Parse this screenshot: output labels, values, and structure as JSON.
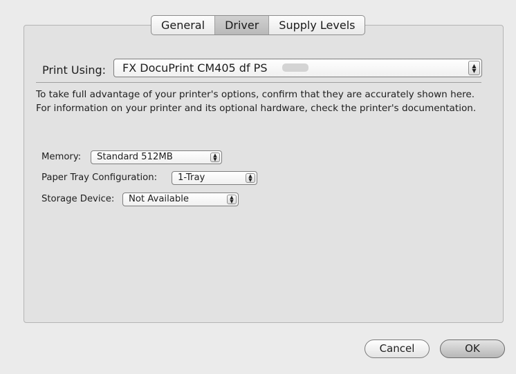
{
  "tabs": [
    {
      "label": "General",
      "selected": false
    },
    {
      "label": "Driver",
      "selected": true
    },
    {
      "label": "Supply Levels",
      "selected": false
    }
  ],
  "print_using": {
    "label": "Print Using:",
    "value": "FX DocuPrint CM405 df PS"
  },
  "description": "To take full advantage of your printer's options, confirm that they are accurately shown here. For information on your printer and its optional hardware, check the printer's documentation.",
  "options": {
    "memory": {
      "label": "Memory:",
      "value": "Standard 512MB"
    },
    "paper_tray": {
      "label": "Paper Tray Configuration:",
      "value": "1-Tray"
    },
    "storage": {
      "label": "Storage Device:",
      "value": "Not Available"
    }
  },
  "buttons": {
    "cancel": "Cancel",
    "ok": "OK"
  },
  "icons": {
    "popup_arrows": "up-down-arrows-icon"
  }
}
